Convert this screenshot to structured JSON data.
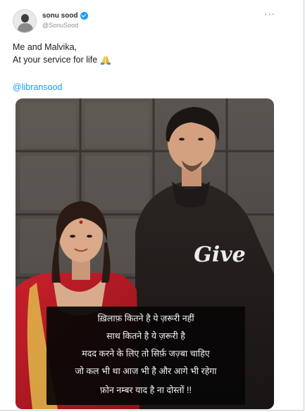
{
  "tweet": {
    "author_name": "sonu sood",
    "author_handle": "@SonuSood",
    "verified": true,
    "text_line1": "Me and Malvika,",
    "text_line2": "At your service for life",
    "mention": "@libransood",
    "more_icon": "···"
  },
  "photo": {
    "shirt_text": "Give",
    "caption_lines": [
      "ख़िलाफ़ कितने है ये ज़रूरी नहीं",
      "साथ कितने है ये ज़रूरी है",
      "मदद करने के लिए तो सिर्फ़ जज़्बा चाहिए",
      "जो कल भी था आज भी है और आगे भी रहेगा",
      "फ़ोन नम्बर याद है ना दोस्तों !!"
    ]
  },
  "colors": {
    "link": "#1d9bf0",
    "text": "#1c1c1c",
    "muted": "#8a8f94",
    "caption_bg": "#080606"
  },
  "icons": {
    "verified": "verified-badge-icon",
    "more": "more-options-icon",
    "pray": "folded-hands-icon"
  }
}
